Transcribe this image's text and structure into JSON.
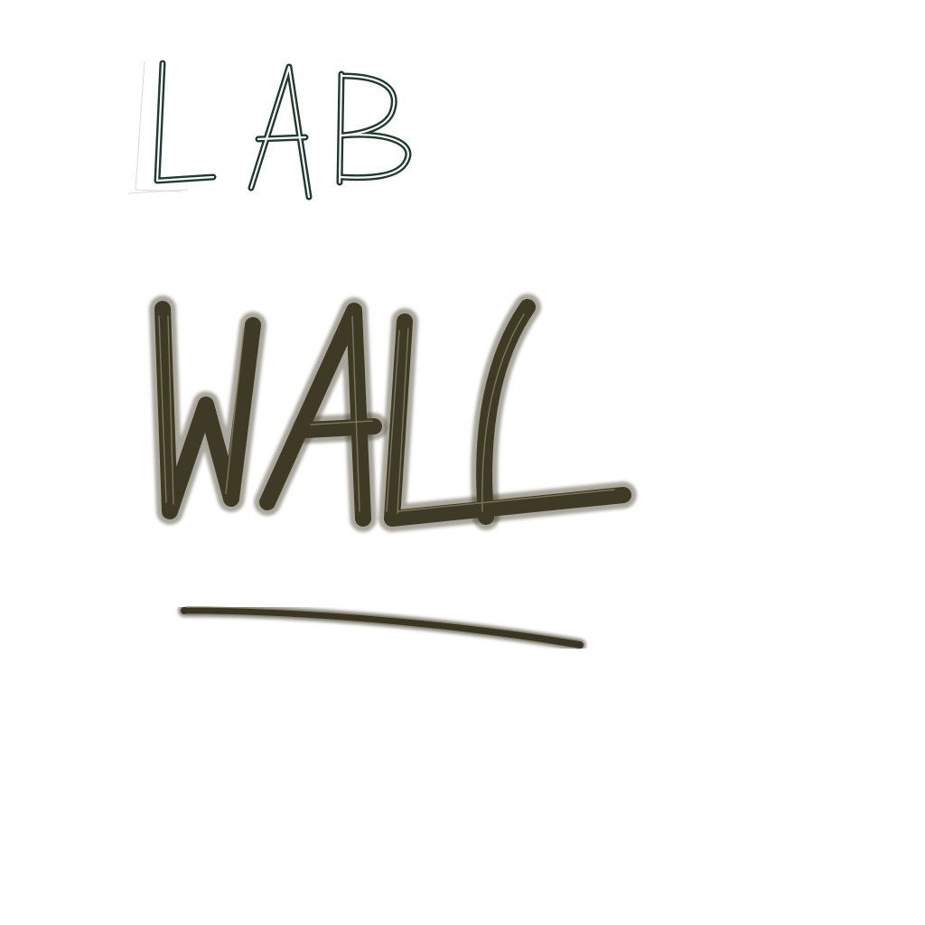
{
  "sketch": {
    "top_word": "LAB",
    "main_word": "WALL",
    "background_color": "#ffffff",
    "top_word_color": "#1f3a2e",
    "main_word_color": "#3f3a26",
    "underline_color": "#3a3626"
  }
}
